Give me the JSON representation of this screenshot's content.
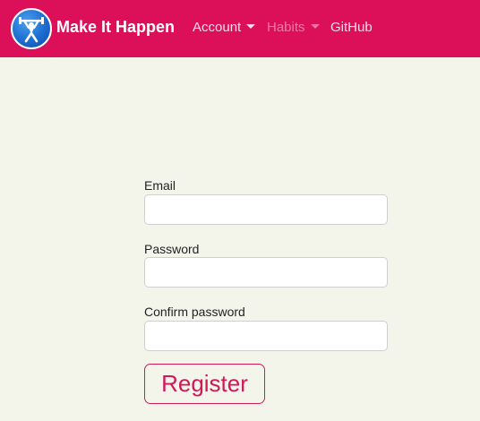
{
  "navbar": {
    "brand": "Make It Happen",
    "logo_icon": "weightlifter-icon",
    "background_color": "#dc1058",
    "links": [
      {
        "label": "Account",
        "has_dropdown": true
      },
      {
        "label": "Habits",
        "has_dropdown": true,
        "muted": true
      },
      {
        "label": "GitHub",
        "has_dropdown": false
      }
    ]
  },
  "form": {
    "email_label": "Email",
    "email_value": "",
    "password_label": "Password",
    "password_value": "",
    "confirm_label": "Confirm password",
    "confirm_value": "",
    "submit_label": "Register",
    "accent_color": "#d1185a"
  },
  "page": {
    "background_color": "#f4f5ea"
  }
}
